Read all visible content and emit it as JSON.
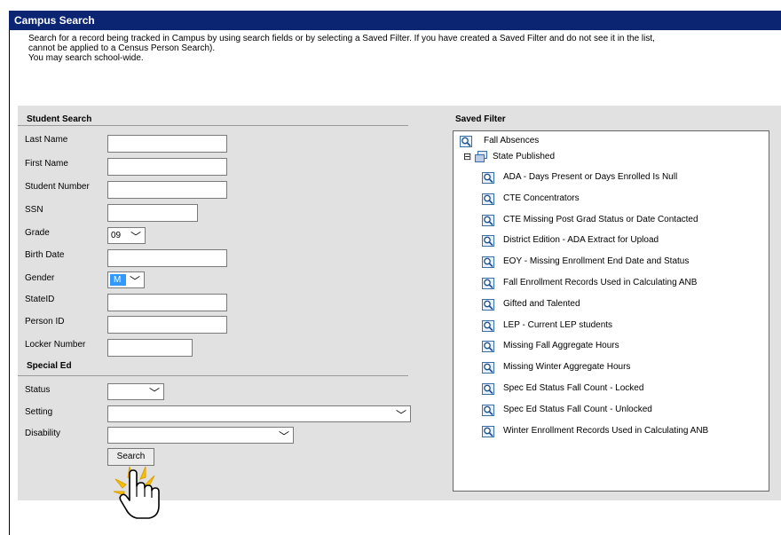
{
  "window": {
    "title": "Campus Search"
  },
  "intro": {
    "line1": "Search for a record being tracked in Campus by using search fields or by selecting a Saved Filter. If you have created a Saved Filter and do not see it in the list,",
    "line2": "cannot be applied to a Census Person Search).",
    "line3": "You may search school-wide."
  },
  "student_search": {
    "header": "Student Search",
    "last_name": {
      "label": "Last Name",
      "value": ""
    },
    "first_name": {
      "label": "First Name",
      "value": ""
    },
    "student_number": {
      "label": "Student Number",
      "value": ""
    },
    "ssn": {
      "label": "SSN",
      "value": ""
    },
    "grade": {
      "label": "Grade",
      "value": "09"
    },
    "birth_date": {
      "label": "Birth Date",
      "value": ""
    },
    "gender": {
      "label": "Gender",
      "value": "M"
    },
    "state_id": {
      "label": "StateID",
      "value": ""
    },
    "person_id": {
      "label": "Person ID",
      "value": ""
    },
    "locker_number": {
      "label": "Locker Number",
      "value": ""
    }
  },
  "special_ed": {
    "header": "Special Ed",
    "status": {
      "label": "Status",
      "value": ""
    },
    "setting": {
      "label": "Setting",
      "value": ""
    },
    "disability": {
      "label": "Disability",
      "value": ""
    }
  },
  "search_button": "Search",
  "saved_filter": {
    "header": "Saved Filter",
    "top_item": "Fall Absences",
    "folder": "State Published",
    "folder_toggle": "⊟",
    "items": [
      "ADA - Days Present or Days Enrolled Is Null",
      "CTE Concentrators",
      "CTE Missing Post Grad Status or Date Contacted",
      "District Edition - ADA Extract for Upload",
      "EOY - Missing Enrollment End Date and Status",
      "Fall Enrollment Records Used in Calculating ANB",
      "Gifted and Talented",
      "LEP - Current LEP students",
      "Missing Fall Aggregate Hours",
      "Missing Winter Aggregate Hours",
      "Spec Ed Status Fall Count - Locked",
      "Spec Ed Status Fall Count - Unlocked",
      "Winter Enrollment Records Used in Calculating ANB"
    ]
  },
  "colors": {
    "titlebar": "#0b2573",
    "panel": "#e1e1e1",
    "gender_selected": "#3399ff"
  }
}
